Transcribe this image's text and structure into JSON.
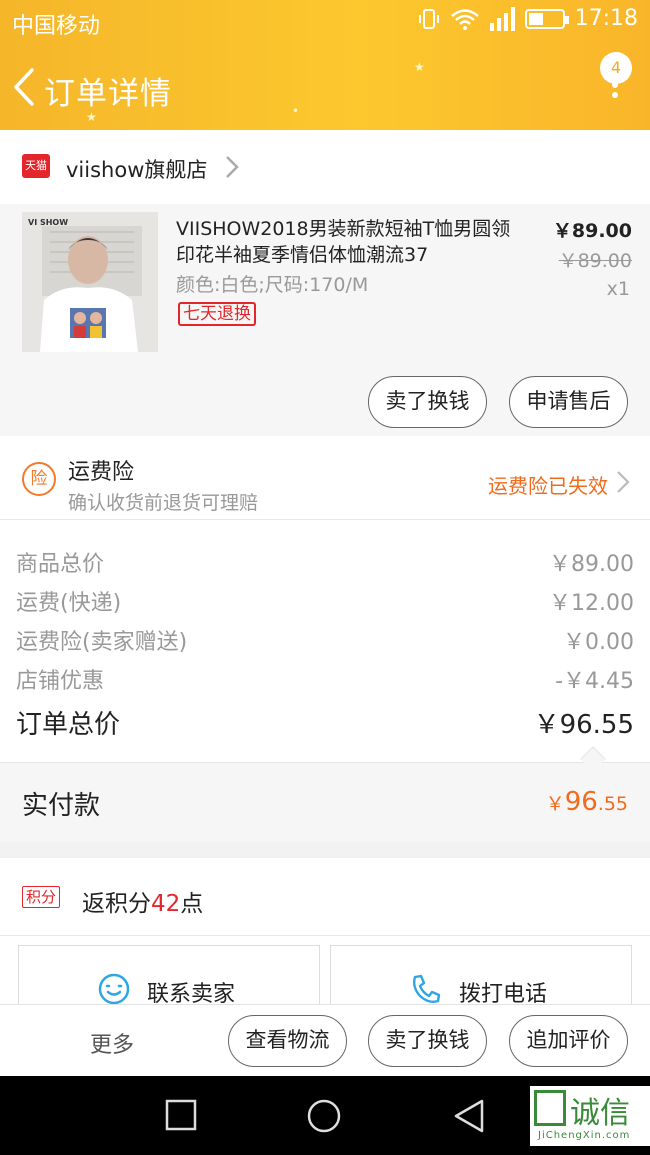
{
  "status_bar": {
    "carrier": "中国移动",
    "time": "17:18",
    "network": "G"
  },
  "header": {
    "title": "订单详情",
    "badge_count": "4",
    "colors": {
      "gradient_start": "#f5b62a",
      "gradient_end": "#fcc82e"
    }
  },
  "shop": {
    "platform_icon_text": "天猫",
    "name": "viishow旗舰店"
  },
  "product": {
    "title": "VIISHOW2018男装新款短袖T恤男圆领印花半袖夏季情侣体恤潮流37",
    "spec": "颜色:白色;尺码:170/M",
    "tag": "七天退换",
    "price": "￥89.00",
    "original_price": "￥89.00",
    "quantity": "x1",
    "thumb_brand": "VI SHOW",
    "buttons": {
      "sell": "卖了换钱",
      "after_sale": "申请售后"
    }
  },
  "insurance": {
    "icon_text": "险",
    "title": "运费险",
    "subtitle": "确认收货前退货可理赔",
    "status": "运费险已失效"
  },
  "summary": {
    "rows": [
      {
        "label": "商品总价",
        "value": "￥89.00"
      },
      {
        "label": "运费(快递)",
        "value": "￥12.00"
      },
      {
        "label": "运费险(卖家赠送)",
        "value": "￥0.00"
      },
      {
        "label": "店铺优惠",
        "value": "-￥4.45"
      }
    ],
    "total_label": "订单总价",
    "total_value": "￥96.55"
  },
  "paid": {
    "label": "实付款",
    "currency": "￥",
    "integer": "96",
    "decimal": ".55",
    "color": "#f26a1b"
  },
  "points": {
    "tag": "积分",
    "text_prefix": "返积分",
    "amount": "42",
    "text_suffix": "点"
  },
  "contact": {
    "seller": "联系卖家",
    "call": "拨打电话"
  },
  "actions": {
    "more": "更多",
    "logistics": "查看物流",
    "sell": "卖了换钱",
    "review": "追加评价"
  },
  "watermark": {
    "title": "诚信",
    "site": "JiChengXin.com"
  }
}
